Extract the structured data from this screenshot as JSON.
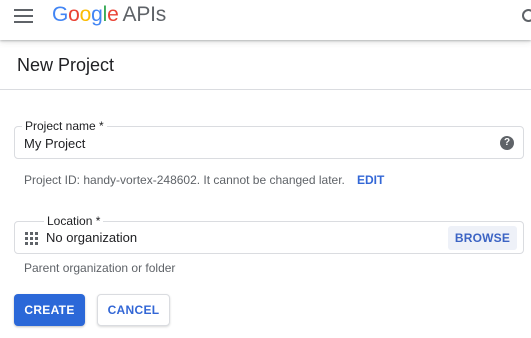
{
  "header": {
    "logo": {
      "google_letters": [
        {
          "char": "G",
          "color": "#4285F4"
        },
        {
          "char": "o",
          "color": "#EA4335"
        },
        {
          "char": "o",
          "color": "#FBBC05"
        },
        {
          "char": "g",
          "color": "#4285F4"
        },
        {
          "char": "l",
          "color": "#34A853"
        },
        {
          "char": "e",
          "color": "#EA4335"
        }
      ],
      "suffix": "APIs"
    },
    "menu_icon": "hamburger-menu-icon",
    "search_icon": "search-icon"
  },
  "page": {
    "title": "New Project"
  },
  "form": {
    "project_name": {
      "label": "Project name *",
      "value": "My Project",
      "help_icon": "help-circle-icon",
      "help_glyph": "?"
    },
    "project_id_hint": "Project ID: handy-vortex-248602. It cannot be changed later.",
    "edit_label": "EDIT",
    "location": {
      "label": "Location *",
      "value": "No organization",
      "icon": "organization-icon",
      "browse_label": "BROWSE",
      "helper": "Parent organization or folder"
    }
  },
  "actions": {
    "create_label": "CREATE",
    "cancel_label": "CANCEL"
  },
  "colors": {
    "primary_button": "#2b68d8",
    "link": "#3367d6",
    "border": "#dadce0"
  }
}
